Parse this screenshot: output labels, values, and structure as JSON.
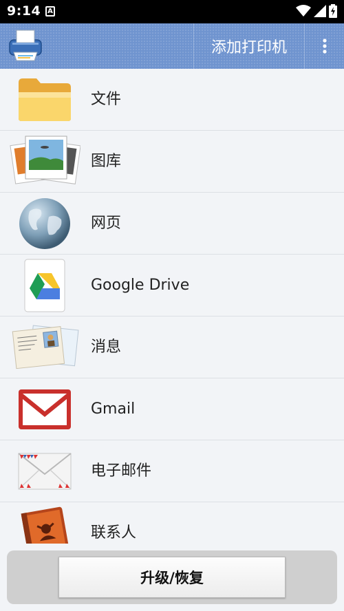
{
  "status_bar": {
    "time": "9:14",
    "notification_glyph": "A",
    "icons": [
      "wifi-icon",
      "signal-icon",
      "battery-charging-icon"
    ]
  },
  "app_bar": {
    "logo_icon": "printer-logo-icon",
    "add_printer_label": "添加打印机",
    "menu_icon": "overflow-menu-icon"
  },
  "list": {
    "items": [
      {
        "label": "文件",
        "icon": "folder-icon"
      },
      {
        "label": "图库",
        "icon": "photo-gallery-icon"
      },
      {
        "label": "网页",
        "icon": "globe-icon"
      },
      {
        "label": "Google Drive",
        "icon": "google-drive-icon"
      },
      {
        "label": "消息",
        "icon": "message-postcard-icon"
      },
      {
        "label": "Gmail",
        "icon": "gmail-icon"
      },
      {
        "label": "电子邮件",
        "icon": "email-envelope-icon"
      },
      {
        "label": "联系人",
        "icon": "contacts-book-icon"
      }
    ]
  },
  "footer": {
    "upgrade_label": "升级/恢复"
  },
  "colors": {
    "app_bar": "#6f94cf",
    "list_background": "#f2f4f7",
    "divider": "#dcdfe4"
  }
}
